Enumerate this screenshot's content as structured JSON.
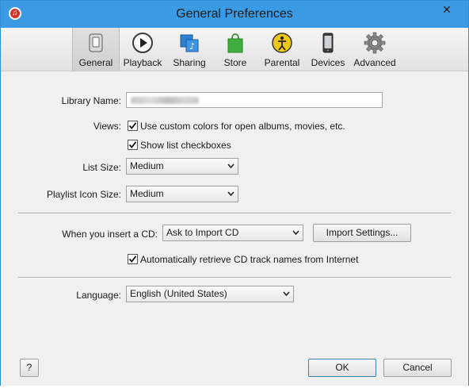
{
  "window": {
    "title": "General Preferences",
    "close_glyph": "✕"
  },
  "toolbar": {
    "tabs": [
      {
        "label": "General",
        "icon": "general-device-icon",
        "active": true
      },
      {
        "label": "Playback",
        "icon": "play-icon"
      },
      {
        "label": "Sharing",
        "icon": "sharing-icon"
      },
      {
        "label": "Store",
        "icon": "store-bag-icon"
      },
      {
        "label": "Parental",
        "icon": "parental-icon"
      },
      {
        "label": "Devices",
        "icon": "device-icon"
      },
      {
        "label": "Advanced",
        "icon": "gear-icon"
      }
    ]
  },
  "form": {
    "library_name_label": "Library Name:",
    "views_label": "Views:",
    "custom_colors_label": "Use custom colors for open albums, movies, etc.",
    "custom_colors_checked": true,
    "show_checkboxes_label": "Show list checkboxes",
    "show_checkboxes_checked": true,
    "list_size_label": "List Size:",
    "list_size_value": "Medium",
    "playlist_icon_size_label": "Playlist Icon Size:",
    "playlist_icon_size_value": "Medium",
    "insert_cd_label": "When you insert a CD:",
    "insert_cd_value": "Ask to Import CD",
    "import_settings_button": "Import Settings...",
    "auto_retrieve_label": "Automatically retrieve CD track names from Internet",
    "auto_retrieve_checked": true,
    "language_label": "Language:",
    "language_value": "English (United States)"
  },
  "footer": {
    "help_button": "?",
    "ok_button": "OK",
    "cancel_button": "Cancel"
  },
  "colors": {
    "titlebar": "#3a9ae3",
    "window_border": "#2f8fd6",
    "dialog_background": "#f0f0f0"
  }
}
